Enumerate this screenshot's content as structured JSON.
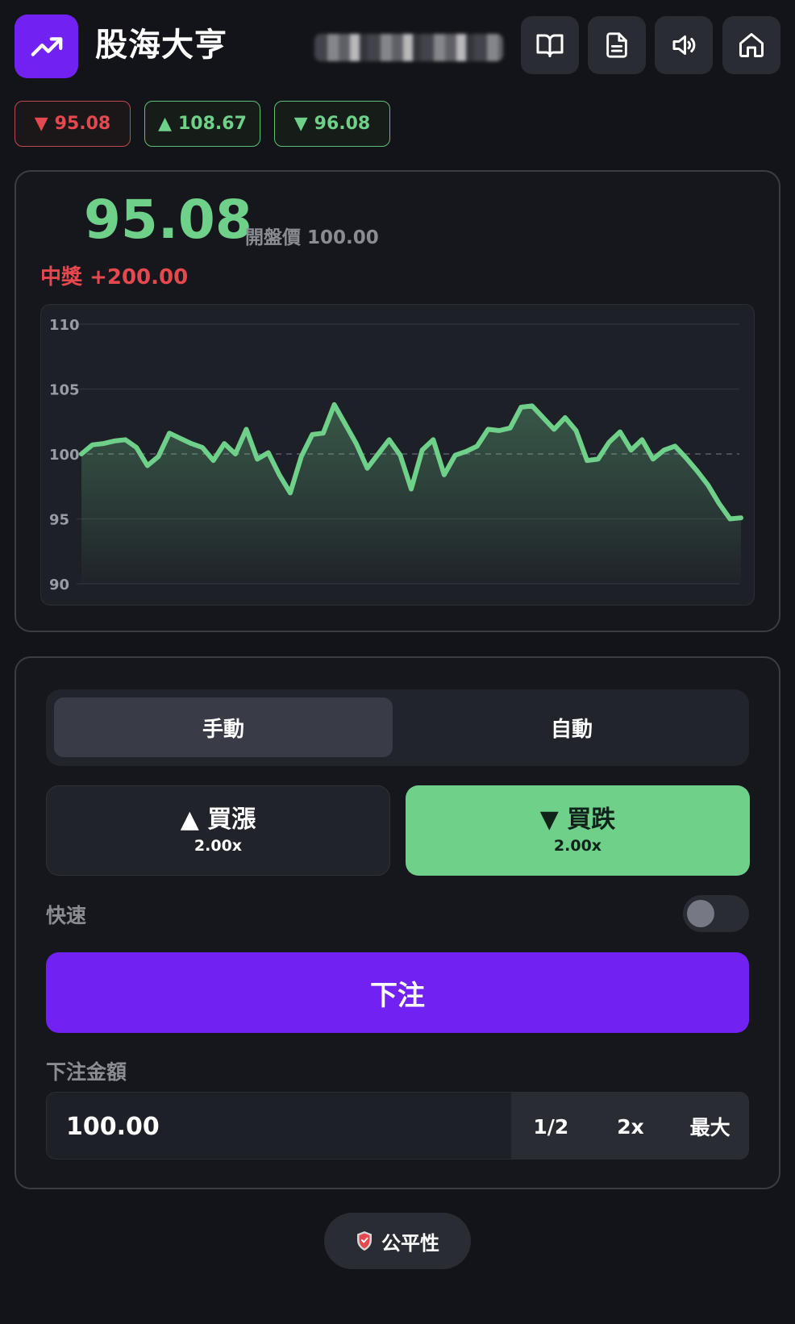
{
  "header": {
    "title": "股海大亨",
    "icons": [
      "trending-up-icon",
      "book-icon",
      "document-icon",
      "volume-icon",
      "home-icon"
    ]
  },
  "history": [
    {
      "arrow": "▼",
      "value": "95.08",
      "color": "#e5484d"
    },
    {
      "arrow": "▲",
      "value": "108.67",
      "color": "#6fd08a"
    },
    {
      "arrow": "▼",
      "value": "96.08",
      "color": "#6fd08a"
    }
  ],
  "price": {
    "current": "95.08",
    "open_label": "開盤價",
    "open_value": "100.00",
    "win_label": "中獎",
    "win_value": "+200.00"
  },
  "chart_data": {
    "type": "line",
    "ylim": [
      90,
      110
    ],
    "yticks": [
      "110",
      "105",
      "100",
      "95",
      "90"
    ],
    "baseline": 100,
    "line_color": "#6fd08a",
    "values": [
      100.0,
      100.7,
      100.8,
      101.0,
      101.1,
      100.5,
      99.1,
      99.8,
      101.6,
      101.2,
      100.8,
      100.5,
      99.5,
      100.8,
      100.0,
      101.9,
      99.6,
      100.1,
      98.4,
      97.0,
      99.8,
      101.5,
      101.6,
      103.8,
      102.3,
      100.8,
      98.9,
      100.0,
      101.1,
      99.9,
      97.3,
      100.3,
      101.1,
      98.4,
      99.9,
      100.2,
      100.6,
      101.9,
      101.8,
      102.0,
      103.6,
      103.7,
      102.8,
      101.9,
      102.8,
      101.8,
      99.5,
      99.6,
      100.9,
      101.7,
      100.3,
      101.1,
      99.6,
      100.3,
      100.6,
      99.7,
      98.7,
      97.6,
      96.2,
      95.0,
      95.08
    ]
  },
  "bet": {
    "tab_manual": "手動",
    "tab_auto": "自動",
    "up_label": "▲ 買漲",
    "up_mult": "2.00x",
    "down_label": "▼ 買跌",
    "down_mult": "2.00x",
    "fast_label": "快速",
    "fast_on": false,
    "place_label": "下注",
    "amount_label": "下注金額",
    "amount_value": "100.00",
    "half_label": "1/2",
    "double_label": "2x",
    "max_label": "最大"
  },
  "footer": {
    "fairness_label": "公平性"
  }
}
